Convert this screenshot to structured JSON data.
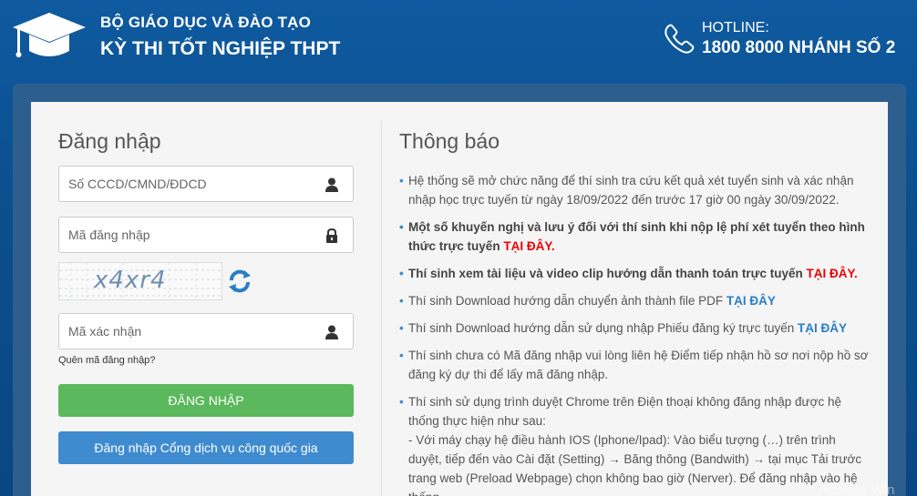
{
  "header": {
    "org": "BỘ GIÁO DỤC VÀ ĐÀO TẠO",
    "exam": "KỲ THI TỐT NGHIỆP THPT",
    "hotline_label": "HOTLINE:",
    "hotline_number": "1800 8000 NHÁNH SỐ 2"
  },
  "login": {
    "title": "Đăng nhập",
    "id_placeholder": "Số CCCD/CMND/ĐDCD",
    "code_placeholder": "Mã đăng nhập",
    "captcha_text": "x4xr4",
    "verify_placeholder": "Mã xác nhận",
    "forgot": "Quên mã đăng nhập?",
    "login_button": "ĐĂNG NHẬP",
    "portal_button": "Đăng nhập Cổng dịch vụ công quốc gia"
  },
  "notices": {
    "title": "Thông báo",
    "n1": "Hệ thống sẽ mở chức năng để thí sinh tra cứu kết quả xét tuyển sinh và xác nhận nhập học trực tuyến từ ngày 18/09/2022 đến trước 17 giờ 00 ngày 30/09/2022.",
    "n2": "Một số khuyến nghị và lưu ý đối với thí sinh khi nộp lệ phí xét tuyển theo hình thức trực tuyến ",
    "n2_link": "TẠI ĐÂY.",
    "n3": "Thí sinh xem tài liệu và video clip hướng dẫn thanh toán trực tuyến ",
    "n3_link": "TẠI ĐÂY.",
    "n4": "Thí sinh Download hướng dẫn chuyển ảnh thành file PDF ",
    "n4_link": "TẠI ĐÂY",
    "n5": "Thí sinh Download hướng dẫn sử dụng nhập Phiếu đăng ký trực tuyến ",
    "n5_link": "TẠI ĐÂY",
    "n6": "Thí sinh chưa có Mã đăng nhập vui lòng liên hệ Điểm tiếp nhận hồ sơ nơi nộp hồ sơ đăng ký dự thi để lấy mã đăng nhập.",
    "n7": "Thí sinh sử dụng trình duyệt Chrome trên Điện thoại không đăng nhập được hệ thống thực hiện như sau:",
    "n7_sub": " - Với máy chạy hệ điều hành IOS (Iphone/Ipad): Vào biểu tượng (…) trên trình duyệt, tiếp đến vào Cài đặt (Setting) → Băng thông (Bandwith) → tại mục Tải trước trang web (Preload Webpage) chọn không bao giờ (Nerver). Để đăng nhập vào hệ thống"
  },
  "watermark": "Activate Win",
  "colors": {
    "green": "#5cb85c",
    "blue": "#3f8bd0",
    "red": "#e00000"
  }
}
